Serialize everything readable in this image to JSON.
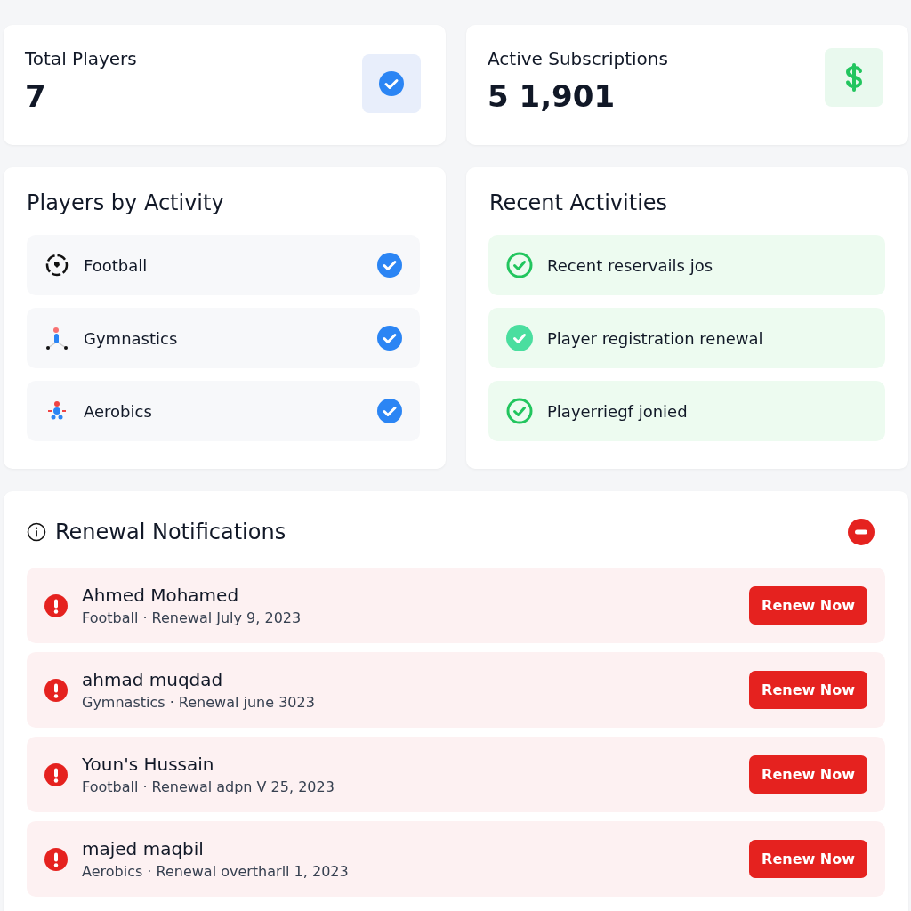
{
  "stats": [
    {
      "label": "Total Players",
      "value": "7",
      "kind": "check"
    },
    {
      "label": "Active Subscriptions",
      "value": "5 1,901",
      "kind": "dollar"
    }
  ],
  "players_by_activity": {
    "title": "Players by Activity",
    "items": [
      {
        "label": "Football",
        "kind": "ball",
        "checked": true
      },
      {
        "label": "Gymnastics",
        "kind": "gymnast",
        "checked": true
      },
      {
        "label": "Aerobics",
        "kind": "aerobic",
        "checked": true
      }
    ]
  },
  "recent_activities": {
    "title": "Recent Activities",
    "items": [
      {
        "label": "Recent reservails jos",
        "kind": "outline"
      },
      {
        "label": "Player registration renewal",
        "kind": "filled"
      },
      {
        "label": "Playerriegf jonied",
        "kind": "outline"
      }
    ]
  },
  "renewal_notifications": {
    "title": "Renewal Notifications",
    "items": [
      {
        "name": "Ahmed Mohamed",
        "details": "Football · Renewal July 9, 2023",
        "button": "Renew Now"
      },
      {
        "name": "ahmad muqdad",
        "details": "Gymnastics · Renewal june 3023",
        "button": "Renew Now"
      },
      {
        "name": "Youn's Hussain",
        "details": "Football · Renewal adpn V 25, 2023",
        "button": "Renew Now"
      },
      {
        "name": "majed maqbil",
        "details": "Aerobics · Renewal overtharll 1, 2023",
        "button": "Renew Now"
      }
    ]
  }
}
